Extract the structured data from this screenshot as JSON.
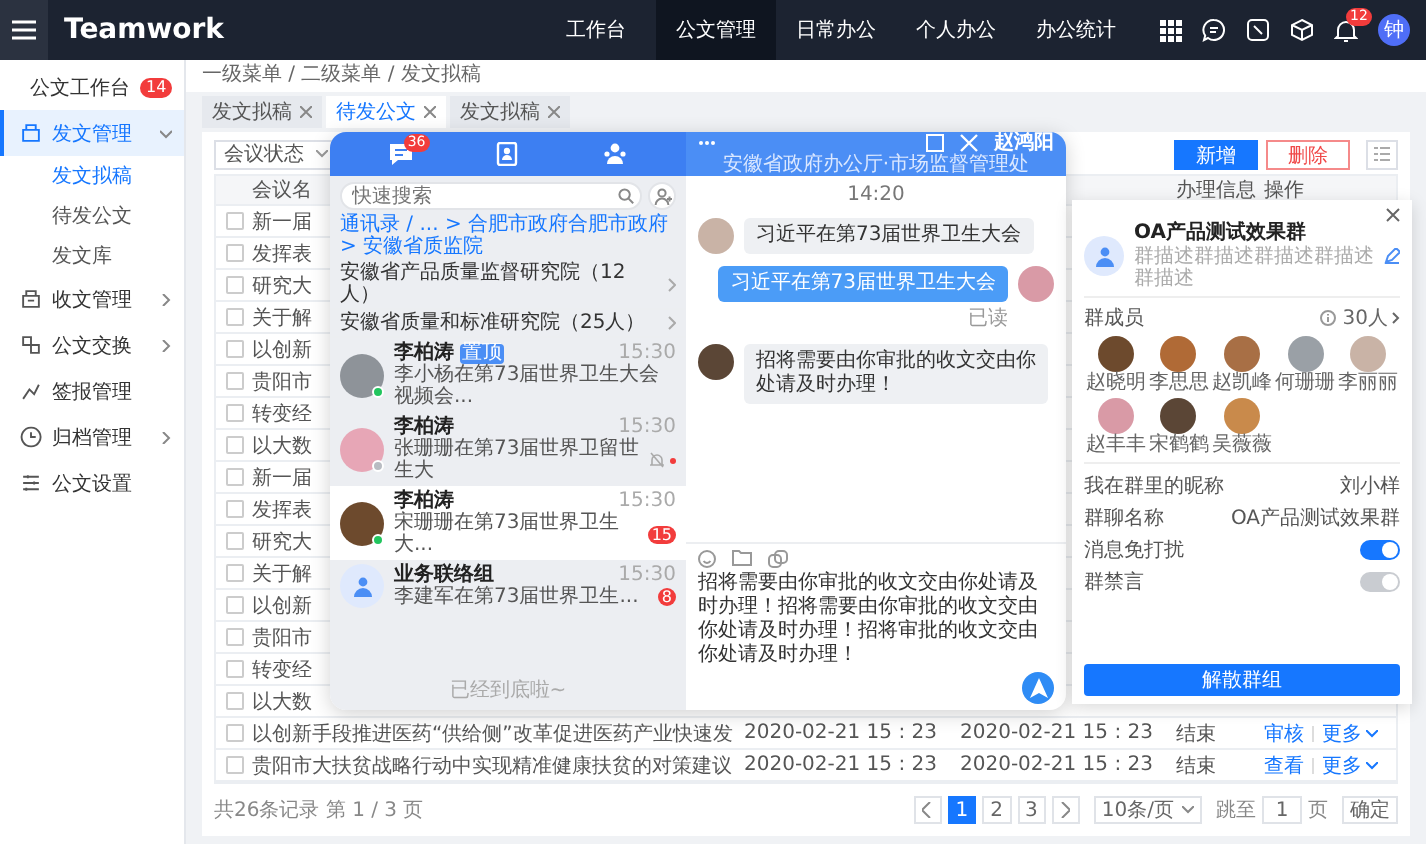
{
  "top_nav": {
    "logo": "Teamwork",
    "items": [
      {
        "label": "工作台",
        "selected": false
      },
      {
        "label": "公文管理",
        "selected": true
      },
      {
        "label": "日常办公",
        "selected": false
      },
      {
        "label": "个人办公",
        "selected": false
      },
      {
        "label": "办公统计",
        "selected": false
      }
    ],
    "notification_count": "12",
    "user_initial": "钟"
  },
  "sidebar": {
    "items": [
      {
        "label": "公文工作台",
        "badge": "14",
        "selected": false
      },
      {
        "label": "发文管理",
        "selected": true,
        "expanded": true,
        "children": [
          {
            "label": "发文拟稿",
            "selected": true
          },
          {
            "label": "待发公文",
            "selected": false
          },
          {
            "label": "发文库",
            "selected": false
          }
        ]
      },
      {
        "label": "收文管理",
        "selected": false,
        "expanded": false
      },
      {
        "label": "公文交换",
        "selected": false,
        "expanded": false
      },
      {
        "label": "签报管理",
        "selected": false
      },
      {
        "label": "归档管理",
        "selected": false,
        "expanded": false
      },
      {
        "label": "公文设置",
        "selected": false
      }
    ]
  },
  "breadcrumb": "一级菜单 / 二级菜单 / 发文拟稿",
  "tabs": [
    {
      "label": "发文拟稿",
      "selected": false
    },
    {
      "label": "待发公文",
      "selected": true
    },
    {
      "label": "发文拟稿",
      "selected": false
    }
  ],
  "filters": {
    "status_select": "会议状态"
  },
  "toolbar": {
    "add_button": "新增",
    "delete_button": "删除"
  },
  "table": {
    "columns": {
      "title": "会议名",
      "status": "办理信息",
      "actions": "操作"
    },
    "rows": [
      {
        "checked": false,
        "title": "新一届"
      },
      {
        "checked": false,
        "title": "发挥表"
      },
      {
        "checked": false,
        "title": "研究大"
      },
      {
        "checked": false,
        "title": "关于解"
      },
      {
        "checked": false,
        "title": "以创新"
      },
      {
        "checked": false,
        "title": "贵阳市"
      },
      {
        "checked": false,
        "title": "转变经"
      },
      {
        "checked": false,
        "title": "以大数"
      },
      {
        "checked": false,
        "title": "新一届"
      },
      {
        "checked": false,
        "title": "发挥表"
      },
      {
        "checked": false,
        "title": "研究大"
      },
      {
        "checked": false,
        "title": "关于解"
      },
      {
        "checked": false,
        "title": "以创新"
      },
      {
        "checked": false,
        "title": "贵阳市"
      },
      {
        "checked": false,
        "title": "转变经"
      },
      {
        "checked": false,
        "title": "以大数"
      },
      {
        "checked": false,
        "title": "以创新手段推进医药“供给侧”改革促进医药产业快速发",
        "start": "2020-02-21 15 : 23",
        "end": "2020-02-21 15 : 23",
        "status": "结束",
        "actions": [
          "审核",
          "更多"
        ]
      },
      {
        "checked": false,
        "title": "贵阳市大扶贫战略行动中实现精准健康扶贫的对策建议",
        "start": "2020-02-21 15 : 23",
        "end": "2020-02-21 15 : 23",
        "status": "结束",
        "actions": [
          "查看",
          "更多"
        ]
      }
    ]
  },
  "footer": {
    "summary": "共26条记录 第 1 / 3 页",
    "pages": [
      {
        "label": "1",
        "selected": true
      },
      {
        "label": "2",
        "selected": false
      },
      {
        "label": "3",
        "selected": false
      }
    ],
    "page_size": "10条/页",
    "jump_label": "跳至",
    "jump_value": "1",
    "page_unit": "页",
    "confirm_button": "确定"
  },
  "chat": {
    "nav_badge": "36",
    "search_placeholder": "快速搜索",
    "path": "通讯录 / ... > 合肥市政府合肥市政府 > 安徽省质监院",
    "groups": [
      "安徽省产品质量监督研究院（12人）",
      "安徽省质量和标准研究院（25人）"
    ],
    "conversations": [
      {
        "kind": "person",
        "name": "李柏涛",
        "tag": "置顶",
        "time": "15:30",
        "preview": "李小杨在第73届世界卫生大会视频会...",
        "online": true,
        "muted": false,
        "unread_dot": false,
        "selected": false
      },
      {
        "kind": "person",
        "name": "李柏涛",
        "time": "15:30",
        "preview": "张珊珊在第73届世界卫留世生大",
        "online": false,
        "muted": true,
        "unread_dot": true,
        "selected": false
      },
      {
        "kind": "person",
        "name": "李柏涛",
        "time": "15:30",
        "preview": "宋珊珊在第73届世界卫生大...",
        "online": true,
        "muted": false,
        "unread_dot": false,
        "unread": "15",
        "selected": true
      },
      {
        "kind": "group",
        "name": "业务联络组",
        "time": "15:30",
        "preview": "李建军在第73届世界卫生...",
        "muted": false,
        "unread_dot": false,
        "unread": "8",
        "selected": false
      }
    ],
    "end_note": "已经到底啦~",
    "title": "赵鸿阳",
    "subtitle": "安徽省政府办公厅·市场监督管理处",
    "time": "14:20",
    "messages": [
      {
        "outgoing": false,
        "text": "习近平在第73届世界卫生大会"
      },
      {
        "outgoing": true,
        "text": "习近平在第73届世界卫生大会",
        "receipt": "已读"
      },
      {
        "outgoing": false,
        "text": "招将需要由你审批的收文交由你处请及时办理！"
      }
    ],
    "draft": "招将需要由你审批的收文交由你处请及时办理！招将需要由你审批的收文交由你处请及时办理！招将审批的收文交由你处请及时办理！"
  },
  "group_panel": {
    "name": "OA产品测试效果群",
    "description": "群描述群描述群描述群描述群描述",
    "members_label": "群成员",
    "member_count": "30人",
    "members": [
      "赵晓明",
      "李思思",
      "赵凯峰",
      "何珊珊",
      "李丽丽",
      "赵丰丰",
      "宋鹤鹤",
      "吴薇薇"
    ],
    "settings": [
      {
        "kind": "text",
        "label": "我在群里的昵称",
        "value": "刘小样"
      },
      {
        "kind": "text",
        "label": "群聊名称",
        "value": "OA产品测试效果群"
      },
      {
        "kind": "toggle",
        "label": "消息免打扰",
        "on": true,
        "disabled": false
      },
      {
        "kind": "toggle",
        "label": "群禁言",
        "on": true,
        "disabled": true
      }
    ],
    "dismiss_button": "解散群组"
  }
}
